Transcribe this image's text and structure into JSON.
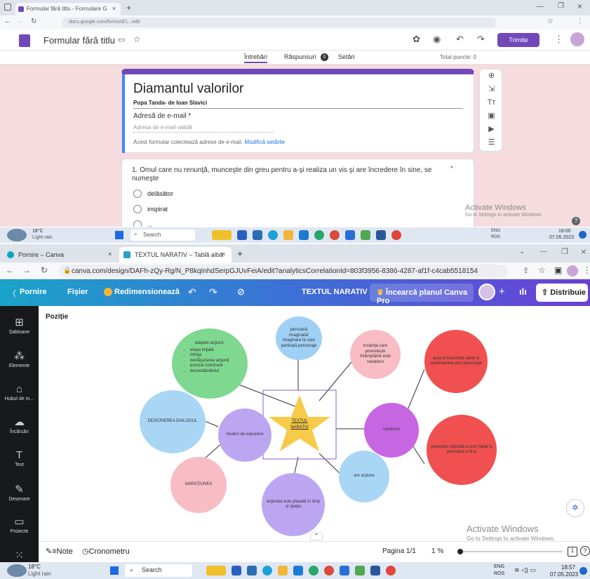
{
  "top": {
    "tab_title": "Formular fără titlu - Formulare G",
    "url": "docs.google.com/forms/d/1...edit",
    "form_title_app": "Formular fără titlu",
    "send_button": "Trimite",
    "tabs": [
      "Întrebări",
      "Răspunsuri",
      "Setări"
    ],
    "responses_badge": "0",
    "total_points": "Total puncte: 0",
    "form": {
      "title": "Diamantul valorilor",
      "description": "Popa Tanda- de Ioan Slavici",
      "email_label": "Adresă de e-mail *",
      "email_placeholder": "Adresa de e-mail validă",
      "collect_note": "Acest formular colectează adrese de e-mail.",
      "collect_link": "Modifică setările"
    },
    "question": {
      "text": "1. Omul care nu renunţă, munceşte din greu pentru a-şi realiza un vis şi are încredere în sine, se numeşte",
      "required": "*",
      "options": [
        "delăsător",
        "inspirat",
        "..."
      ]
    },
    "watermark_title": "Activate Windows",
    "watermark_sub": "Go to Settings to activate Windows.",
    "taskbar": {
      "weather_temp": "18°C",
      "weather_desc": "Light rain",
      "search": "Search",
      "lang1": "ENG",
      "lang2": "ROS",
      "time": "18:00",
      "date": "07.05.2023"
    }
  },
  "bottom": {
    "tab1": "Pornire – Canva",
    "tab2": "TEXTUL NARATIV – Tablă albă",
    "url": "canva.com/design/DAFh-zQy-Rg/N_P8kqInhdSerpGJUvFeiA/edit?analyticsCorrelationId=803f3956-8386-4287-af1f-c4cab5518154",
    "toolbar": {
      "home": "Pornire",
      "file": "Fișier",
      "resize": "Redimensionează",
      "doc_title": "TEXTUL NARATIV",
      "pro": "Încearcă planul Canva Pro",
      "share": "Distribuie"
    },
    "sidebar": [
      "Șabloane",
      "Elemente",
      "Hubul de m...",
      "Încărcări",
      "Text",
      "Desenare",
      "Proiecte"
    ],
    "position_label": "Poziție",
    "diagram": {
      "center": [
        "TEXTUL",
        "NARATIV"
      ],
      "n_green_title": "etapele acţiunii:",
      "n_green_items": [
        "etapa iniţială",
        "intriga",
        "desfăşurarea acţiunii",
        "punctul culminant",
        "deznodământul"
      ],
      "n_blue_top": "persoană imaginată/ imaginare la care participă personaje",
      "n_pink_top": "instanţa care povesteşte întâmplările este naratorul",
      "n_red_top": "autorul transmite ideile și sentimentele prin personaje",
      "n_blue_left": "DESCRIEREA DIALOGUL",
      "n_purple_left": "moduri de expunere",
      "n_purple_right": "naratorul",
      "n_red_right": "povestire mijlocită a unor fapte la persoana a III-a",
      "n_pink_bottom": "NARAŢIUNEA",
      "n_purple_bottom": "acţiunea este plasată în timp și spaţiu",
      "n_blue_bottom": "are acţiune"
    },
    "bottombar": {
      "notes": "Note",
      "timer": "Cronometru",
      "page": "Pagina 1/1",
      "zoom": "1 %"
    },
    "watermark_title": "Activate Windows",
    "watermark_sub": "Go to Settings to activate Windows.",
    "taskbar": {
      "weather_temp": "18°C",
      "weather_desc": "Light rain",
      "search": "Search",
      "lang1": "ENG",
      "lang2": "ROS",
      "time": "18:57",
      "date": "07.05.2023"
    }
  }
}
